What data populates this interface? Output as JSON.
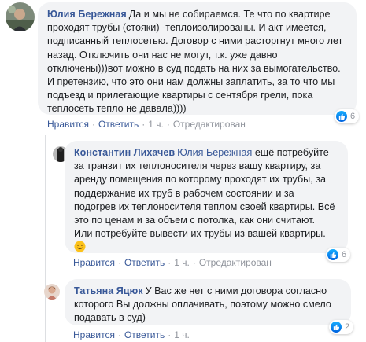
{
  "comments": [
    {
      "author": "Юлия Бережная",
      "lines": [
        "Да и мы не собираемся. Те что по квартире",
        "проходят трубы (стояки) -теплоизолированы. И акт имеется,",
        "подписанный теплосетью. Договор с ними расторгнут много лет",
        "назад. Отключить они нас не могут, т.к. уже давно",
        "отключены)))вот можно в суд подать на них за вымогательство.",
        "И претензию, что это они нам должны заплатить, за то что мы",
        "подъезд и прилегающие квартиры с сентября грели, пока",
        "теплосеть тепло не давала))))"
      ],
      "actions": {
        "like": "Нравится",
        "reply": "Ответить",
        "time": "1 ч.",
        "edited": "Отредактирован"
      },
      "reaction_count": "6"
    },
    {
      "author": "Константин Лихачев",
      "tag": "Юлия Бережная",
      "lines": [
        "ещё потребуйте",
        "за транзит их теплоносителя через вашу квартиру, за",
        "аренду помещения по которому проходят их трубы, за",
        "поддержание их труб в рабочем состоянии и за",
        "подогрев их теплоносителя теплом своей квартиры. Всё",
        "это по ценам и за объем с потолка, как они считают.",
        "Или потребуйте вывести их трубы из вашей квартиры."
      ],
      "emoji": "smiling-face-emoji",
      "actions": {
        "like": "Нравится",
        "reply": "Ответить",
        "time": "1 ч.",
        "edited": "Отредактирован"
      },
      "reaction_count": "6"
    },
    {
      "author": "Татьяна Яцюк",
      "lines": [
        "У Вас же нет с ними договора согласно",
        "которого Вы должны оплачивать, поэтому можно смело",
        "подавать в суд)"
      ],
      "actions": {
        "like": "Нравится",
        "reply": "Ответить",
        "time": "1 ч."
      },
      "reaction_count": "2"
    }
  ],
  "colors": {
    "link": "#385898",
    "bubble": "#f2f3f5",
    "meta": "#606770",
    "like": "#1877f2"
  }
}
